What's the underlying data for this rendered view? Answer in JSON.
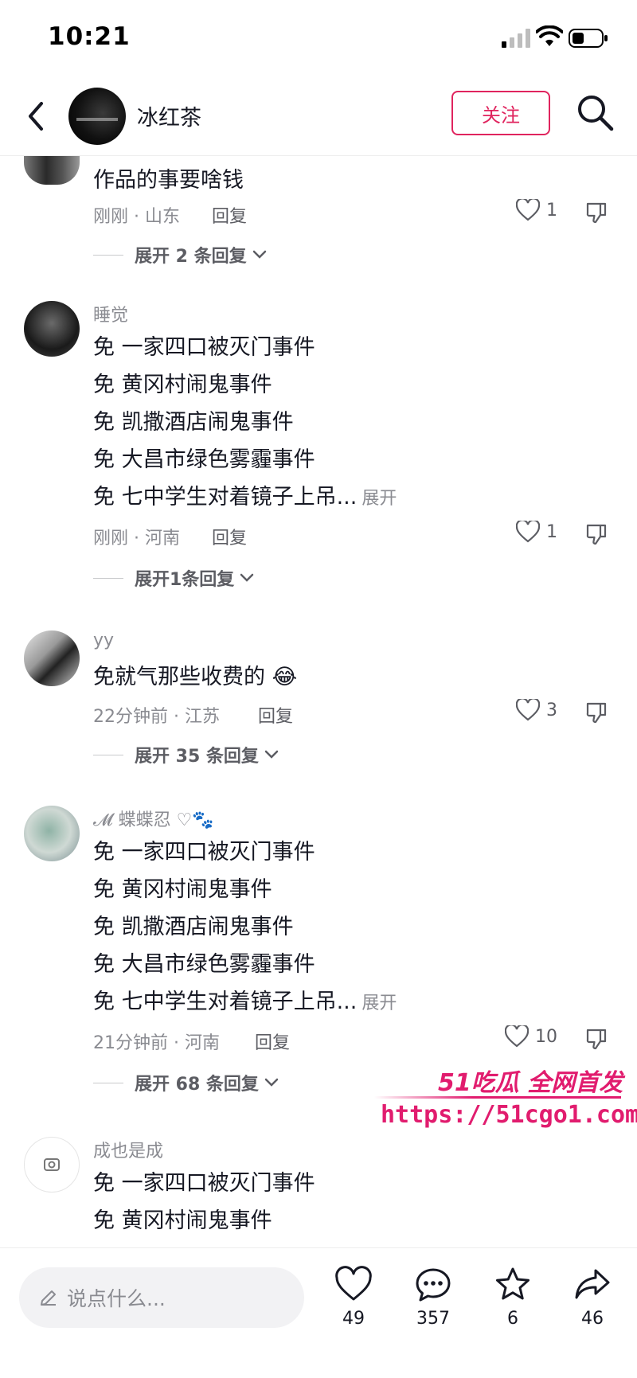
{
  "status_bar": {
    "time": "10:21"
  },
  "header": {
    "author_name": "冰红茶",
    "follow_label": "关注"
  },
  "comments": [
    {
      "name": "",
      "lines": [
        "作品的事要啥钱"
      ],
      "more": "",
      "meta": "刚刚 · 山东",
      "reply_label": "回复",
      "likes": "1",
      "expand": "展开 2 条回复"
    },
    {
      "name": "睡觉",
      "lines": [
        "免 一家四口被灭门事件",
        "免 黄冈村闹鬼事件",
        "免 凯撒酒店闹鬼事件",
        "免 大昌市绿色雾霾事件",
        "免 七中学生对着镜子上吊..."
      ],
      "more": "展开",
      "meta": "刚刚 · 河南",
      "reply_label": "回复",
      "likes": "1",
      "expand": "展开1条回复"
    },
    {
      "name": "yy",
      "lines": [
        "免就气那些收费的 😂"
      ],
      "more": "",
      "meta": "22分钟前 · 江苏",
      "reply_label": "回复",
      "likes": "3",
      "expand": "展开 35 条回复"
    },
    {
      "name": "𝓜 蝶蝶忍 ♡🐾",
      "lines": [
        "免 一家四口被灭门事件",
        "免 黄冈村闹鬼事件",
        "免 凯撒酒店闹鬼事件",
        "免 大昌市绿色雾霾事件",
        "免 七中学生对着镜子上吊..."
      ],
      "more": "展开",
      "meta": "21分钟前 · 河南",
      "reply_label": "回复",
      "likes": "10",
      "expand": "展开 68 条回复"
    },
    {
      "name": "成也是成",
      "lines": [
        "免 一家四口被灭门事件",
        "免 黄冈村闹鬼事件"
      ],
      "more": "",
      "meta": "",
      "reply_label": "",
      "likes": "",
      "expand": ""
    }
  ],
  "watermark": {
    "brand": "51吃瓜 全网首发",
    "url": "https://51cgo1.com"
  },
  "bottom_bar": {
    "input_placeholder": "说点什么...",
    "like_count": "49",
    "comment_count": "357",
    "favorite_count": "6",
    "share_count": "46"
  },
  "colors": {
    "accent": "#e0245e",
    "muted_text": "#8a8b91",
    "watermark": "#e11c6e"
  },
  "icons": [
    "back-arrow-icon",
    "search-icon",
    "heart-icon",
    "dislike-icon",
    "chevron-down-icon",
    "pencil-icon",
    "comment-icon",
    "star-icon",
    "share-icon"
  ]
}
